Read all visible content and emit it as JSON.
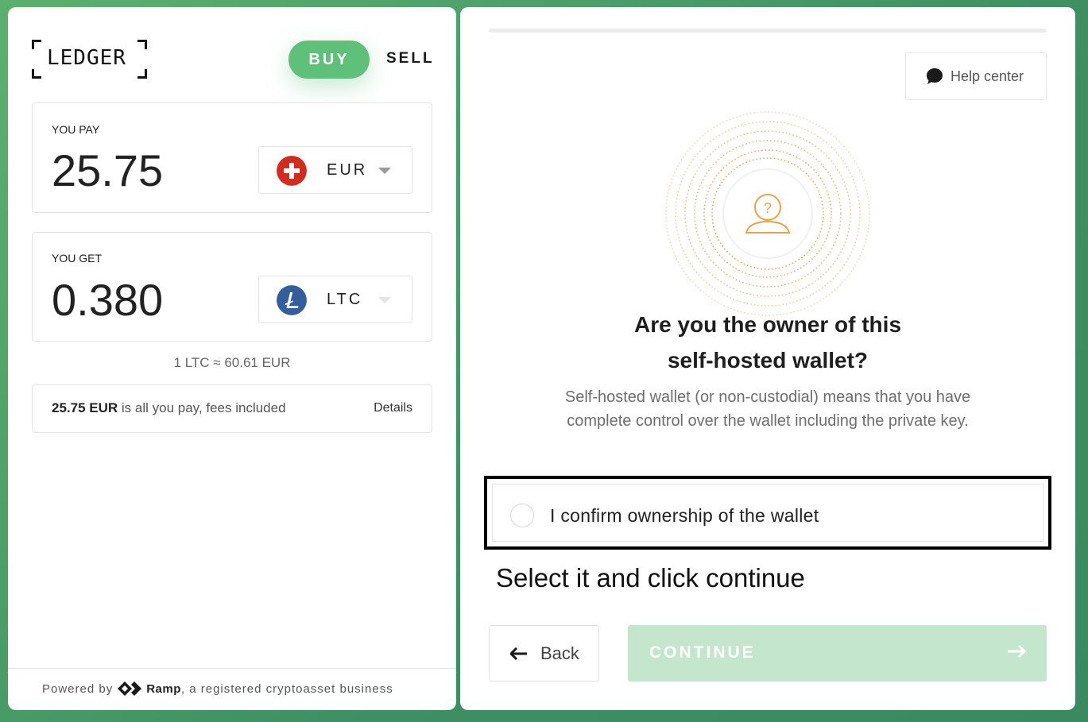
{
  "brand": {
    "logo_text": "LEDGER"
  },
  "mode_tabs": {
    "buy": "BUY",
    "sell": "SELL",
    "active": "buy"
  },
  "pay": {
    "label": "YOU PAY",
    "amount": "25.75",
    "currency": "EUR",
    "currency_icon": "swiss-flag-icon"
  },
  "get": {
    "label": "YOU GET",
    "amount": "0.380",
    "currency": "LTC",
    "currency_icon": "litecoin-icon"
  },
  "rate": "1 LTC ≈ 60.61 EUR",
  "fees": {
    "amount": "25.75 EUR",
    "text": " is all you pay, fees included",
    "details": "Details"
  },
  "footer": {
    "powered_by": "Powered by",
    "provider": "Ramp",
    "suffix": ", a registered cryptoasset business"
  },
  "help": {
    "label": "Help center",
    "icon": "chat-bubble-icon"
  },
  "dialog": {
    "question_line1": "Are you the owner of this",
    "question_line2": "self-hosted wallet?",
    "description": "Self-hosted wallet (or non-custodial) means that you have complete control over the wallet including the private key.",
    "confirm_label": "I confirm ownership of the wallet",
    "confirm_checked": false
  },
  "instruction": "Select it and click continue",
  "nav": {
    "back": "Back",
    "continue": "CONTINUE",
    "continue_enabled": false
  },
  "colors": {
    "accent": "#5fc07a",
    "accent_disabled": "#c3e6cd",
    "illustration": "#e8a34a"
  }
}
